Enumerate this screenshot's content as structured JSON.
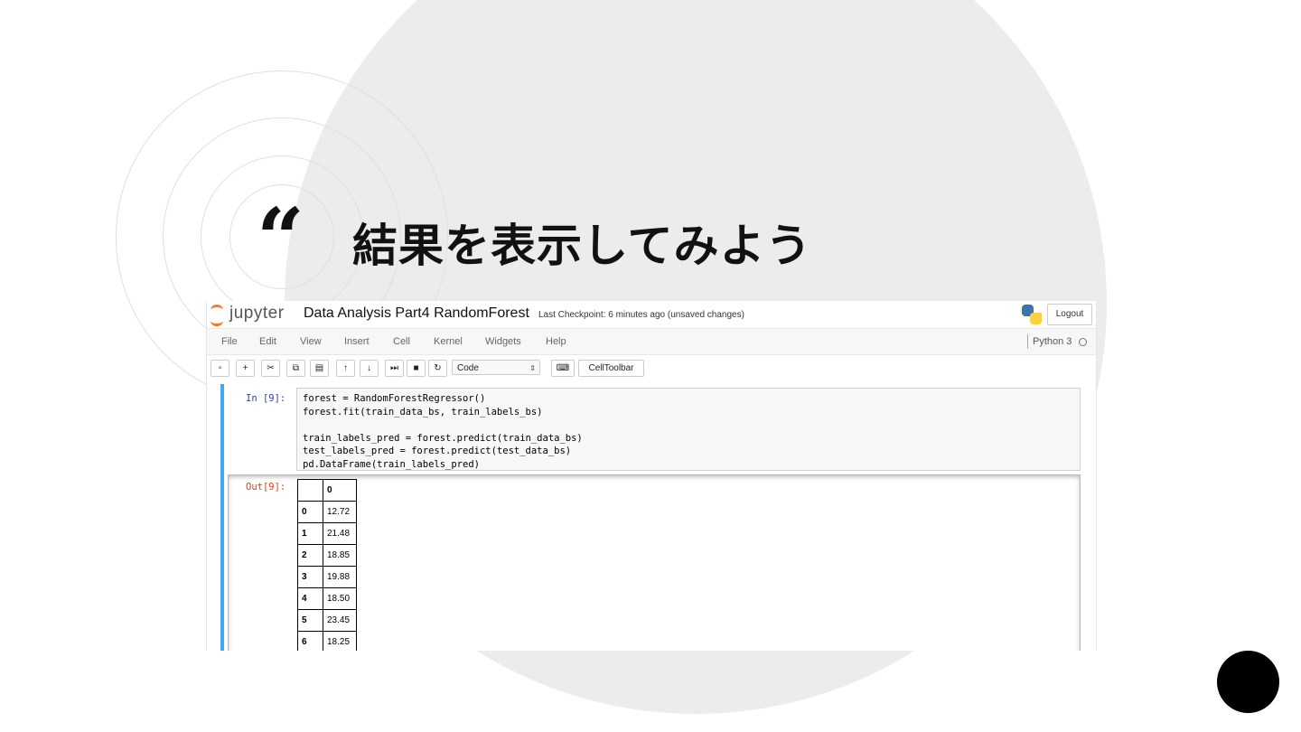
{
  "slide": {
    "quote_mark": "“",
    "title": "結果を表示してみよう"
  },
  "notebook": {
    "app_name": "jupyter",
    "title": "Data Analysis Part4 RandomForest",
    "checkpoint": "Last Checkpoint: 6 minutes ago (unsaved changes)",
    "logout_label": "Logout",
    "menu": [
      "File",
      "Edit",
      "View",
      "Insert",
      "Cell",
      "Kernel",
      "Widgets",
      "Help"
    ],
    "kernel_name": "Python 3",
    "toolbar": {
      "cell_type": "Code",
      "celltoolbar_label": "CellToolbar",
      "icons": [
        "save-icon",
        "plus-icon",
        "cut-icon",
        "copy-icon",
        "paste-icon",
        "arrow-up-icon",
        "arrow-down-icon",
        "run-icon",
        "stop-icon",
        "restart-icon",
        "keyboard-icon"
      ]
    },
    "cell": {
      "in_prompt": "In [9]:",
      "code_lines": [
        "forest = RandomForestRegressor()",
        "forest.fit(train_data_bs, train_labels_bs)",
        "",
        "train_labels_pred = forest.predict(train_data_bs)",
        "test_labels_pred = forest.predict(test_data_bs)",
        "pd.DataFrame(train_labels_pred)"
      ],
      "out_prompt": "Out[9]:",
      "table": {
        "header": [
          "",
          "0"
        ],
        "rows": [
          [
            "0",
            "12.72"
          ],
          [
            "1",
            "21.48"
          ],
          [
            "2",
            "18.85"
          ],
          [
            "3",
            "19.88"
          ],
          [
            "4",
            "18.50"
          ],
          [
            "5",
            "23.45"
          ],
          [
            "6",
            "18.25"
          ]
        ]
      }
    }
  }
}
